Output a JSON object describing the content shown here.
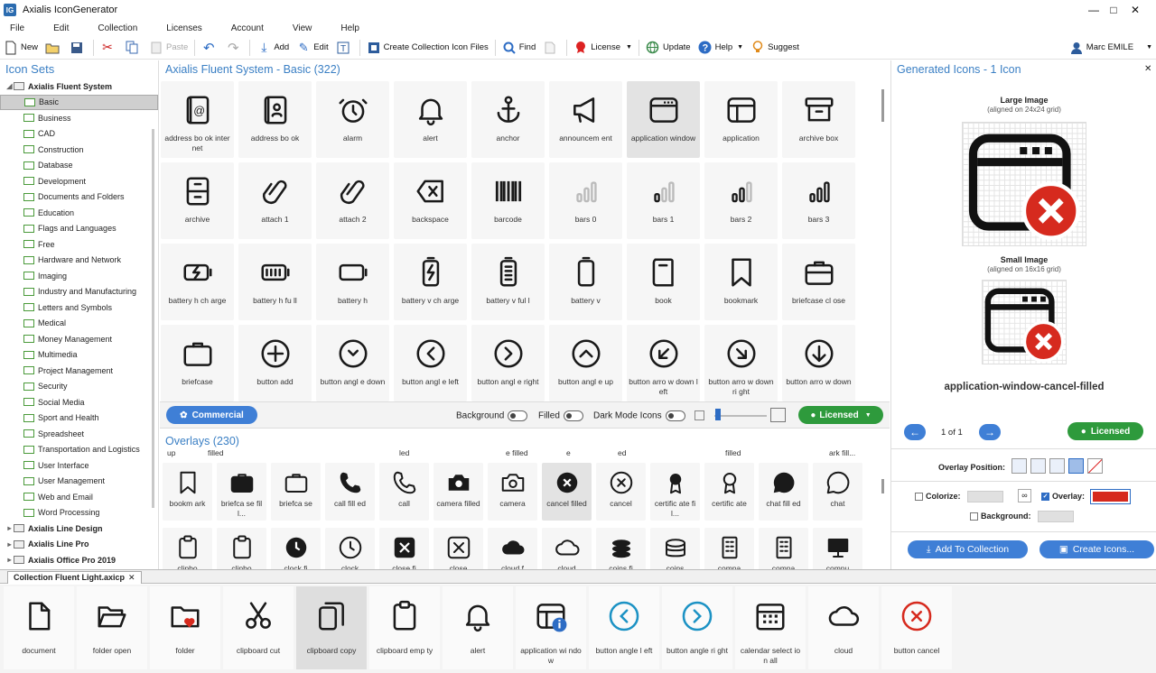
{
  "window": {
    "title": "Axialis IconGenerator",
    "app_icon": "IG"
  },
  "menu": [
    "File",
    "Edit",
    "Collection",
    "Licenses",
    "Account",
    "View",
    "Help"
  ],
  "toolbar": {
    "new": "New",
    "paste": "Paste",
    "add": "Add",
    "edit": "Edit",
    "create_collection": "Create Collection Icon Files",
    "find": "Find",
    "license": "License",
    "update": "Update",
    "help": "Help",
    "suggest": "Suggest",
    "user": "Marc EMILE"
  },
  "left_panel": {
    "title": "Icon Sets",
    "root": "Axialis Fluent System",
    "items": [
      "Basic",
      "Business",
      "CAD",
      "Construction",
      "Database",
      "Development",
      "Documents and Folders",
      "Education",
      "Flags and Languages",
      "Free",
      "Hardware and Network",
      "Imaging",
      "Industry and Manufacturing",
      "Letters and Symbols",
      "Medical",
      "Money Management",
      "Multimedia",
      "Project Management",
      "Security",
      "Social Media",
      "Sport and Health",
      "Spreadsheet",
      "Transportation and Logistics",
      "User Interface",
      "User Management",
      "Web and Email",
      "Word Processing"
    ],
    "other_sets": [
      "Axialis Line Design",
      "Axialis Line Pro",
      "Axialis Office Pro 2019"
    ]
  },
  "main": {
    "title": "Axialis Fluent System - Basic (322)",
    "icons": [
      "address bo ok internet",
      "address bo ok",
      "alarm",
      "alert",
      "anchor",
      "announcem ent",
      "application window",
      "application",
      "archive box",
      "archive",
      "attach 1",
      "attach 2",
      "backspace",
      "barcode",
      "bars 0",
      "bars 1",
      "bars 2",
      "bars 3",
      "battery h ch arge",
      "battery h fu ll",
      "battery h",
      "battery v ch arge",
      "battery v ful l",
      "battery v",
      "book",
      "bookmark",
      "briefcase cl ose",
      "briefcase",
      "button add",
      "button angl e down",
      "button angl e left",
      "button angl e right",
      "button angl e up",
      "button arro w down left",
      "button arro w down ri ght",
      "button arro w down"
    ],
    "bar": {
      "commercial": "Commercial",
      "background": "Background",
      "filled": "Filled",
      "dark_mode": "Dark Mode Icons",
      "licensed": "Licensed"
    }
  },
  "overlays": {
    "title": "Overlays (230)",
    "partial_row": [
      "up",
      "filled",
      "led",
      "e filled",
      "e",
      "ed",
      "filled",
      "ark fill..."
    ],
    "icons": [
      "bookm ark",
      "briefca se fill...",
      "briefca se",
      "call fill ed",
      "call",
      "camera filled",
      "camera",
      "cancel filled",
      "cancel",
      "certific ate fil...",
      "certific ate",
      "chat fill ed",
      "chat"
    ],
    "partial_bottom": [
      "clipbo",
      "clipbo",
      "clock fi",
      "clock",
      "close fi",
      "close",
      "cloud f",
      "cloud",
      "coins fi",
      "coins",
      "compa",
      "compa",
      "compu"
    ]
  },
  "right_panel": {
    "title": "Generated Icons - 1 Icon",
    "large_label": "Large Image",
    "large_sub": "(aligned on 24x24 grid)",
    "small_label": "Small Image",
    "small_sub": "(aligned on 16x16 grid)",
    "icon_name": "application-window-cancel-filled",
    "pager": "1 of 1",
    "licensed": "Licensed",
    "overlay_position": "Overlay Position:",
    "colorize": "Colorize:",
    "overlay": "Overlay:",
    "background": "Background:",
    "add_to_collection": "Add To Collection",
    "create_icons": "Create Icons...",
    "overlay_color": "#d62a1e"
  },
  "collection": {
    "tab": "Collection Fluent Light.axicp",
    "icons": [
      "document",
      "folder open",
      "folder",
      "clipboard cut",
      "clipboard copy",
      "clipboard emp ty",
      "alert",
      "application wi ndow",
      "button angle l eft",
      "button angle ri ght",
      "calendar select ion all",
      "cloud",
      "button cancel"
    ]
  }
}
